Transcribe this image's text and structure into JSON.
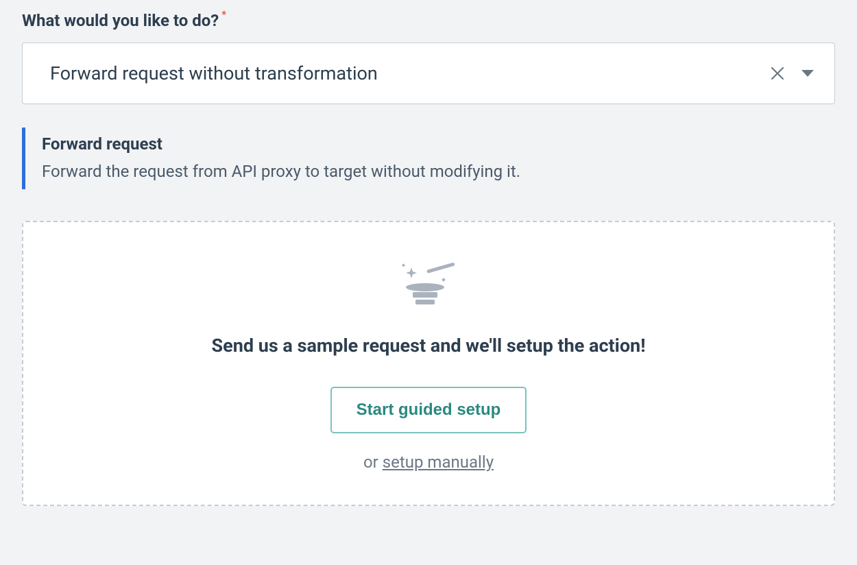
{
  "field": {
    "label": "What would you like to do?",
    "required_marker": "*"
  },
  "select": {
    "value": "Forward request without transformation"
  },
  "info": {
    "title": "Forward request",
    "description": "Forward the request from API proxy to target without modifying it."
  },
  "setup": {
    "heading": "Send us a sample request and we'll setup the action!",
    "guided_button_label": "Start guided setup",
    "or_text": "or",
    "manual_link_text": "setup manually"
  }
}
